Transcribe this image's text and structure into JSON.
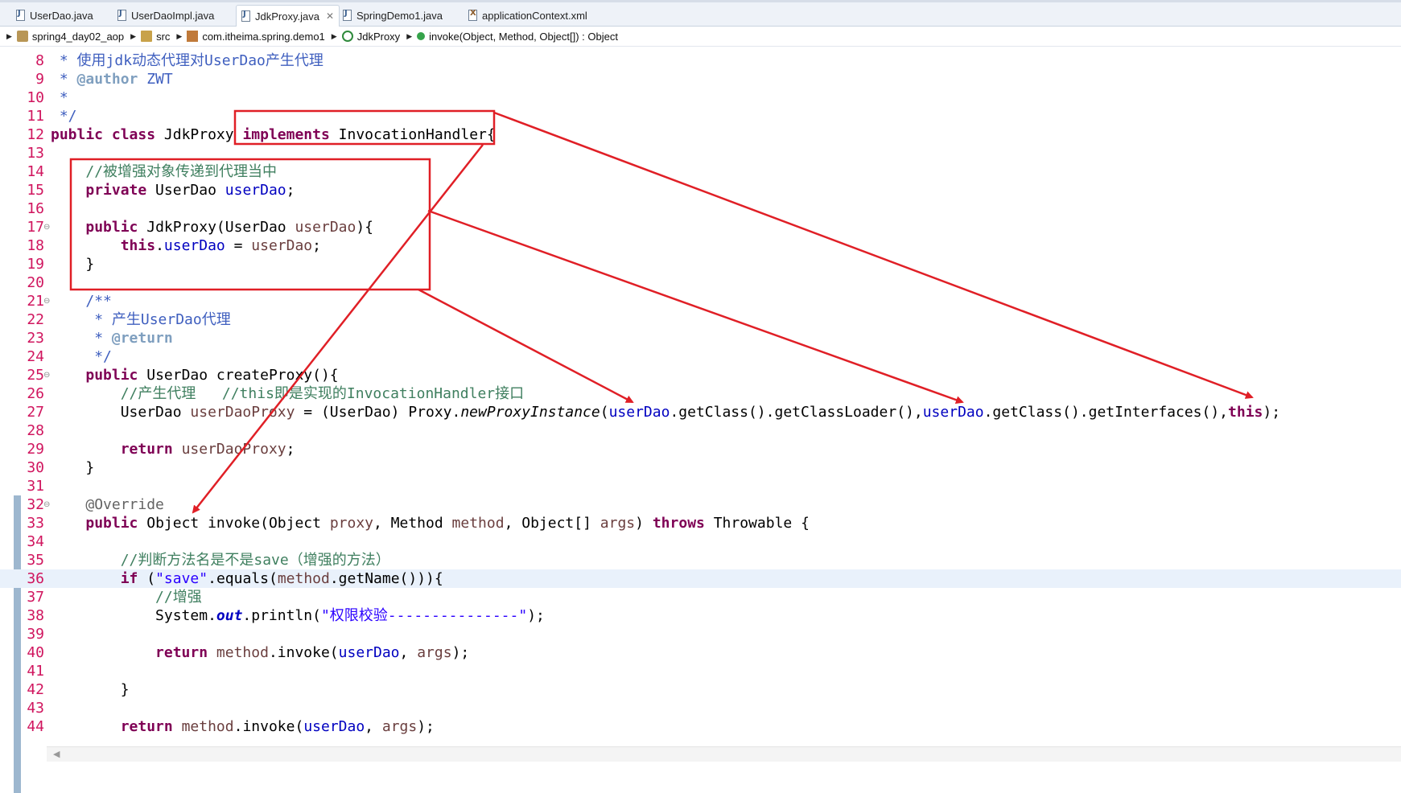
{
  "tabs": [
    {
      "label": "UserDao.java",
      "type": "java",
      "active": false
    },
    {
      "label": "UserDaoImpl.java",
      "type": "java",
      "active": false
    },
    {
      "label": "JdkProxy.java",
      "type": "java",
      "active": true,
      "close_glyph": "✕"
    },
    {
      "label": "SpringDemo1.java",
      "type": "java",
      "active": false
    },
    {
      "label": "applicationContext.xml",
      "type": "xml",
      "active": false
    }
  ],
  "breadcrumb": [
    {
      "label": "spring4_day02_aop",
      "icon": "project-icon"
    },
    {
      "label": "src",
      "icon": "source-folder-icon"
    },
    {
      "label": "com.itheima.spring.demo1",
      "icon": "package-icon"
    },
    {
      "label": "JdkProxy",
      "icon": "class-icon"
    },
    {
      "label": "invoke(Object, Method, Object[]) : Object",
      "icon": "method-icon"
    }
  ],
  "code": {
    "lines": [
      {
        "n": "8",
        "tokens": [
          {
            "t": "jd",
            "v": " * 使用"
          },
          {
            "t": "jd",
            "v": "jdk"
          },
          {
            "t": "jd",
            "v": "动态代理对"
          },
          {
            "t": "jd",
            "v": "UserDao"
          },
          {
            "t": "jd",
            "v": "产生代理"
          }
        ]
      },
      {
        "n": "9",
        "tokens": [
          {
            "t": "jd",
            "v": " * "
          },
          {
            "t": "jdt",
            "v": "@author"
          },
          {
            "t": "jd",
            "v": " ZWT"
          }
        ]
      },
      {
        "n": "10",
        "tokens": [
          {
            "t": "jd",
            "v": " *"
          }
        ]
      },
      {
        "n": "11",
        "tokens": [
          {
            "t": "jd",
            "v": " */"
          }
        ]
      },
      {
        "n": "12",
        "tokens": [
          {
            "t": "kw",
            "v": "public"
          },
          {
            "t": "p",
            "v": " "
          },
          {
            "t": "kw",
            "v": "class"
          },
          {
            "t": "p",
            "v": " JdkProxy "
          },
          {
            "t": "kw",
            "v": "implements"
          },
          {
            "t": "p",
            "v": " InvocationHandler{"
          }
        ]
      },
      {
        "n": "13",
        "tokens": []
      },
      {
        "n": "14",
        "tokens": [
          {
            "t": "p",
            "v": "    "
          },
          {
            "t": "cm",
            "v": "//被增强对象传递到代理当中"
          }
        ]
      },
      {
        "n": "15",
        "tokens": [
          {
            "t": "p",
            "v": "    "
          },
          {
            "t": "kw",
            "v": "private"
          },
          {
            "t": "p",
            "v": " UserDao "
          },
          {
            "t": "fld",
            "v": "userDao"
          },
          {
            "t": "p",
            "v": ";"
          }
        ]
      },
      {
        "n": "16",
        "tokens": []
      },
      {
        "n": "17",
        "fold": "⊖",
        "tokens": [
          {
            "t": "p",
            "v": "    "
          },
          {
            "t": "kw",
            "v": "public"
          },
          {
            "t": "p",
            "v": " JdkProxy(UserDao "
          },
          {
            "t": "var",
            "v": "userDao"
          },
          {
            "t": "p",
            "v": "){"
          }
        ]
      },
      {
        "n": "18",
        "tokens": [
          {
            "t": "p",
            "v": "        "
          },
          {
            "t": "kw",
            "v": "this"
          },
          {
            "t": "p",
            "v": "."
          },
          {
            "t": "fld",
            "v": "userDao"
          },
          {
            "t": "p",
            "v": " = "
          },
          {
            "t": "var",
            "v": "userDao"
          },
          {
            "t": "p",
            "v": ";"
          }
        ]
      },
      {
        "n": "19",
        "tokens": [
          {
            "t": "p",
            "v": "    }"
          }
        ]
      },
      {
        "n": "20",
        "tokens": []
      },
      {
        "n": "21",
        "fold": "⊖",
        "tokens": [
          {
            "t": "p",
            "v": "    "
          },
          {
            "t": "jd",
            "v": "/**"
          }
        ]
      },
      {
        "n": "22",
        "tokens": [
          {
            "t": "p",
            "v": "     "
          },
          {
            "t": "jd",
            "v": "* 产生"
          },
          {
            "t": "jd",
            "v": "UserDao"
          },
          {
            "t": "jd",
            "v": "代理"
          }
        ]
      },
      {
        "n": "23",
        "tokens": [
          {
            "t": "p",
            "v": "     "
          },
          {
            "t": "jd",
            "v": "* "
          },
          {
            "t": "jdt",
            "v": "@return"
          }
        ]
      },
      {
        "n": "24",
        "tokens": [
          {
            "t": "p",
            "v": "     "
          },
          {
            "t": "jd",
            "v": "*/"
          }
        ]
      },
      {
        "n": "25",
        "fold": "⊖",
        "tokens": [
          {
            "t": "p",
            "v": "    "
          },
          {
            "t": "kw",
            "v": "public"
          },
          {
            "t": "p",
            "v": " UserDao createProxy(){"
          }
        ]
      },
      {
        "n": "26",
        "tokens": [
          {
            "t": "p",
            "v": "        "
          },
          {
            "t": "cm",
            "v": "//产生代理   //this即是实现的InvocationHandler接口"
          }
        ]
      },
      {
        "n": "27",
        "tokens": [
          {
            "t": "p",
            "v": "        UserDao "
          },
          {
            "t": "var",
            "v": "userDaoProxy"
          },
          {
            "t": "p",
            "v": " = (UserDao) Proxy."
          },
          {
            "t": "it",
            "v": "newProxyInstance"
          },
          {
            "t": "p",
            "v": "("
          },
          {
            "t": "fld",
            "v": "userDao"
          },
          {
            "t": "p",
            "v": ".getClass().getClassLoader(),"
          },
          {
            "t": "fld",
            "v": "userDao"
          },
          {
            "t": "p",
            "v": ".getClass().getInterfaces(),"
          },
          {
            "t": "kw",
            "v": "this"
          },
          {
            "t": "p",
            "v": ");"
          }
        ]
      },
      {
        "n": "28",
        "tokens": []
      },
      {
        "n": "29",
        "tokens": [
          {
            "t": "p",
            "v": "        "
          },
          {
            "t": "kw",
            "v": "return"
          },
          {
            "t": "p",
            "v": " "
          },
          {
            "t": "var",
            "v": "userDaoProxy"
          },
          {
            "t": "p",
            "v": ";"
          }
        ]
      },
      {
        "n": "30",
        "tokens": [
          {
            "t": "p",
            "v": "    }"
          }
        ]
      },
      {
        "n": "31",
        "tokens": []
      },
      {
        "n": "32",
        "fold": "⊖",
        "tokens": [
          {
            "t": "p",
            "v": "    "
          },
          {
            "t": "ann",
            "v": "@Override"
          }
        ]
      },
      {
        "n": "33",
        "tokens": [
          {
            "t": "p",
            "v": "    "
          },
          {
            "t": "kw",
            "v": "public"
          },
          {
            "t": "p",
            "v": " Object invoke(Object "
          },
          {
            "t": "var",
            "v": "proxy"
          },
          {
            "t": "p",
            "v": ", Method "
          },
          {
            "t": "var",
            "v": "method"
          },
          {
            "t": "p",
            "v": ", Object[] "
          },
          {
            "t": "var",
            "v": "args"
          },
          {
            "t": "p",
            "v": ") "
          },
          {
            "t": "kw",
            "v": "throws"
          },
          {
            "t": "p",
            "v": " Throwable {"
          }
        ]
      },
      {
        "n": "34",
        "tokens": []
      },
      {
        "n": "35",
        "tokens": [
          {
            "t": "p",
            "v": "        "
          },
          {
            "t": "cm",
            "v": "//判断方法名是不是save（增强的方法）"
          }
        ]
      },
      {
        "n": "36",
        "current": true,
        "tokens": [
          {
            "t": "p",
            "v": "        "
          },
          {
            "t": "kw",
            "v": "if"
          },
          {
            "t": "p",
            "v": " ("
          },
          {
            "t": "str",
            "v": "\"save\""
          },
          {
            "t": "p",
            "v": ".equals("
          },
          {
            "t": "var",
            "v": "method"
          },
          {
            "t": "p",
            "v": ".getName())){"
          }
        ]
      },
      {
        "n": "37",
        "tokens": [
          {
            "t": "p",
            "v": "            "
          },
          {
            "t": "cm",
            "v": "//增强"
          }
        ]
      },
      {
        "n": "38",
        "tokens": [
          {
            "t": "p",
            "v": "            System."
          },
          {
            "t": "sfld",
            "v": "out"
          },
          {
            "t": "p",
            "v": ".println("
          },
          {
            "t": "str",
            "v": "\"权限校验---------------\""
          },
          {
            "t": "p",
            "v": ");"
          }
        ]
      },
      {
        "n": "39",
        "tokens": []
      },
      {
        "n": "40",
        "tokens": [
          {
            "t": "p",
            "v": "            "
          },
          {
            "t": "kw",
            "v": "return"
          },
          {
            "t": "p",
            "v": " "
          },
          {
            "t": "var",
            "v": "method"
          },
          {
            "t": "p",
            "v": ".invoke("
          },
          {
            "t": "fld",
            "v": "userDao"
          },
          {
            "t": "p",
            "v": ", "
          },
          {
            "t": "var",
            "v": "args"
          },
          {
            "t": "p",
            "v": ");"
          }
        ]
      },
      {
        "n": "41",
        "tokens": []
      },
      {
        "n": "42",
        "tokens": [
          {
            "t": "p",
            "v": "        }"
          }
        ]
      },
      {
        "n": "43",
        "tokens": []
      },
      {
        "n": "44",
        "tokens": [
          {
            "t": "p",
            "v": "        "
          },
          {
            "t": "kw",
            "v": "return"
          },
          {
            "t": "p",
            "v": " "
          },
          {
            "t": "var",
            "v": "method"
          },
          {
            "t": "p",
            "v": ".invoke("
          },
          {
            "t": "fld",
            "v": "userDao"
          },
          {
            "t": "p",
            "v": ", "
          },
          {
            "t": "var",
            "v": "args"
          },
          {
            "t": "p",
            "v": ");"
          }
        ]
      }
    ]
  },
  "annotation_color": "#e01f26",
  "colors": {
    "keyword": "#7f0055",
    "field": "#0000c0",
    "local_variable": "#6a3e3e",
    "comment": "#3f7f5f",
    "javadoc": "#3f5fbf",
    "string": "#2a00ff",
    "line_number": "#d0155e",
    "current_line": "#e9f1fb"
  }
}
